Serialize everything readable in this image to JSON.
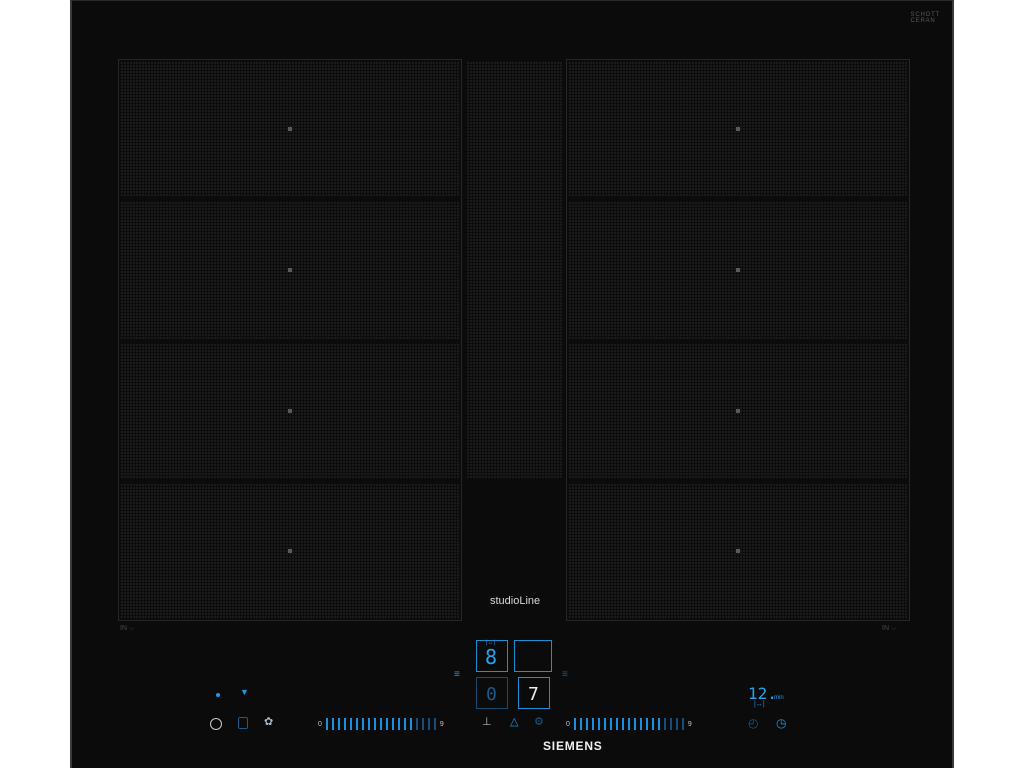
{
  "brand": {
    "logo": "SIEMENS",
    "series": "studioLine",
    "glass_maker": "SCHOTT",
    "glass_type": "CERAN"
  },
  "markings": {
    "in_left": "IN",
    "in_right": "IN"
  },
  "display": {
    "power_top": "8",
    "power_bottom": "0",
    "power_selected": "7",
    "timer_value": "12.",
    "timer_unit": "min"
  },
  "slider_labels": {
    "left_zero": "0",
    "left_end": "9",
    "right_zero": "0",
    "right_end": "9"
  },
  "colors": {
    "glass": "#0b0b0b",
    "zone": "#1b1b1b",
    "accent": "#2196e6"
  },
  "icons": [
    "info-icon",
    "child-lock-icon",
    "fan-icon",
    "wifi-icon",
    "pan-icon",
    "hood-icon",
    "settings-icon",
    "timer-icon",
    "clock-icon"
  ]
}
